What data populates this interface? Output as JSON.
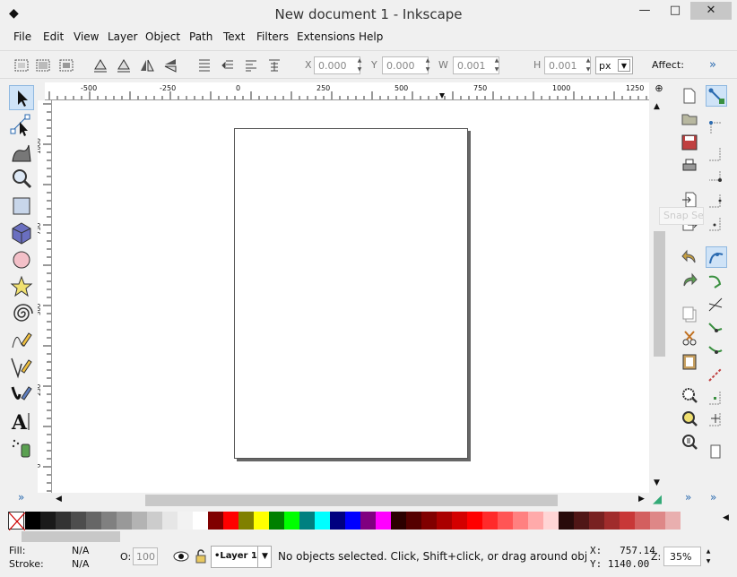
{
  "window": {
    "title": "New document 1 - Inkscape",
    "controls": [
      "minimize",
      "maximize",
      "close"
    ]
  },
  "menubar": [
    "File",
    "Edit",
    "View",
    "Layer",
    "Object",
    "Path",
    "Text",
    "Filters",
    "Extensions",
    "Help"
  ],
  "toolbar": {
    "x_label": "X",
    "x_value": "0.000",
    "y_label": "Y",
    "y_value": "0.000",
    "w_label": "W",
    "w_value": "0.001",
    "h_label": "H",
    "h_value": "0.001",
    "unit": "px",
    "affect_label": "Affect:",
    "more": "»"
  },
  "ruler": {
    "horizontal_ticks": [
      "-500",
      "-250",
      "0",
      "250",
      "500",
      "750",
      "1000",
      "1250"
    ],
    "vertical_ticks": [
      "1000",
      "750",
      "500",
      "250",
      "0"
    ]
  },
  "tools": [
    "selector-tool",
    "node-tool",
    "tweak-tool",
    "zoom-tool",
    "rectangle-tool",
    "3d-box-tool",
    "ellipse-tool",
    "star-tool",
    "spiral-tool",
    "pencil-tool",
    "pen-tool",
    "calligraphy-tool",
    "text-tool",
    "spray-tool"
  ],
  "tools_more": "»",
  "palette_colors": [
    "#000000",
    "#1a1a1a",
    "#333333",
    "#4d4d4d",
    "#666666",
    "#808080",
    "#999999",
    "#b3b3b3",
    "#cccccc",
    "#e6e6e6",
    "#f2f2f2",
    "#ffffff",
    "#800000",
    "#ff0000",
    "#808000",
    "#ffff00",
    "#008000",
    "#00ff00",
    "#008080",
    "#00ffff",
    "#000080",
    "#0000ff",
    "#800080",
    "#ff00ff",
    "#2b0000",
    "#550000",
    "#800000",
    "#aa0000",
    "#d40000",
    "#ff0000",
    "#ff2a2a",
    "#ff5555",
    "#ff8080",
    "#ffaaaa",
    "#ffd5d5",
    "#280b0b",
    "#501616",
    "#782121",
    "#a02c2c",
    "#c83737",
    "#d35f5f",
    "#de8787",
    "#e9afaf"
  ],
  "status": {
    "fill_label": "Fill:",
    "fill_value": "N/A",
    "stroke_label": "Stroke:",
    "stroke_value": "N/A",
    "opacity_label": "O:",
    "opacity_value": "100",
    "layer": "•Layer 1",
    "message": "No objects selected. Click, Shift+click, or drag around objects to s",
    "x_coord": "X:   757.14",
    "y_coord": "Y: 1140.00",
    "zoom_label": "Z:",
    "zoom_value": "35%"
  },
  "tooltip_fragment": "Snap Se"
}
